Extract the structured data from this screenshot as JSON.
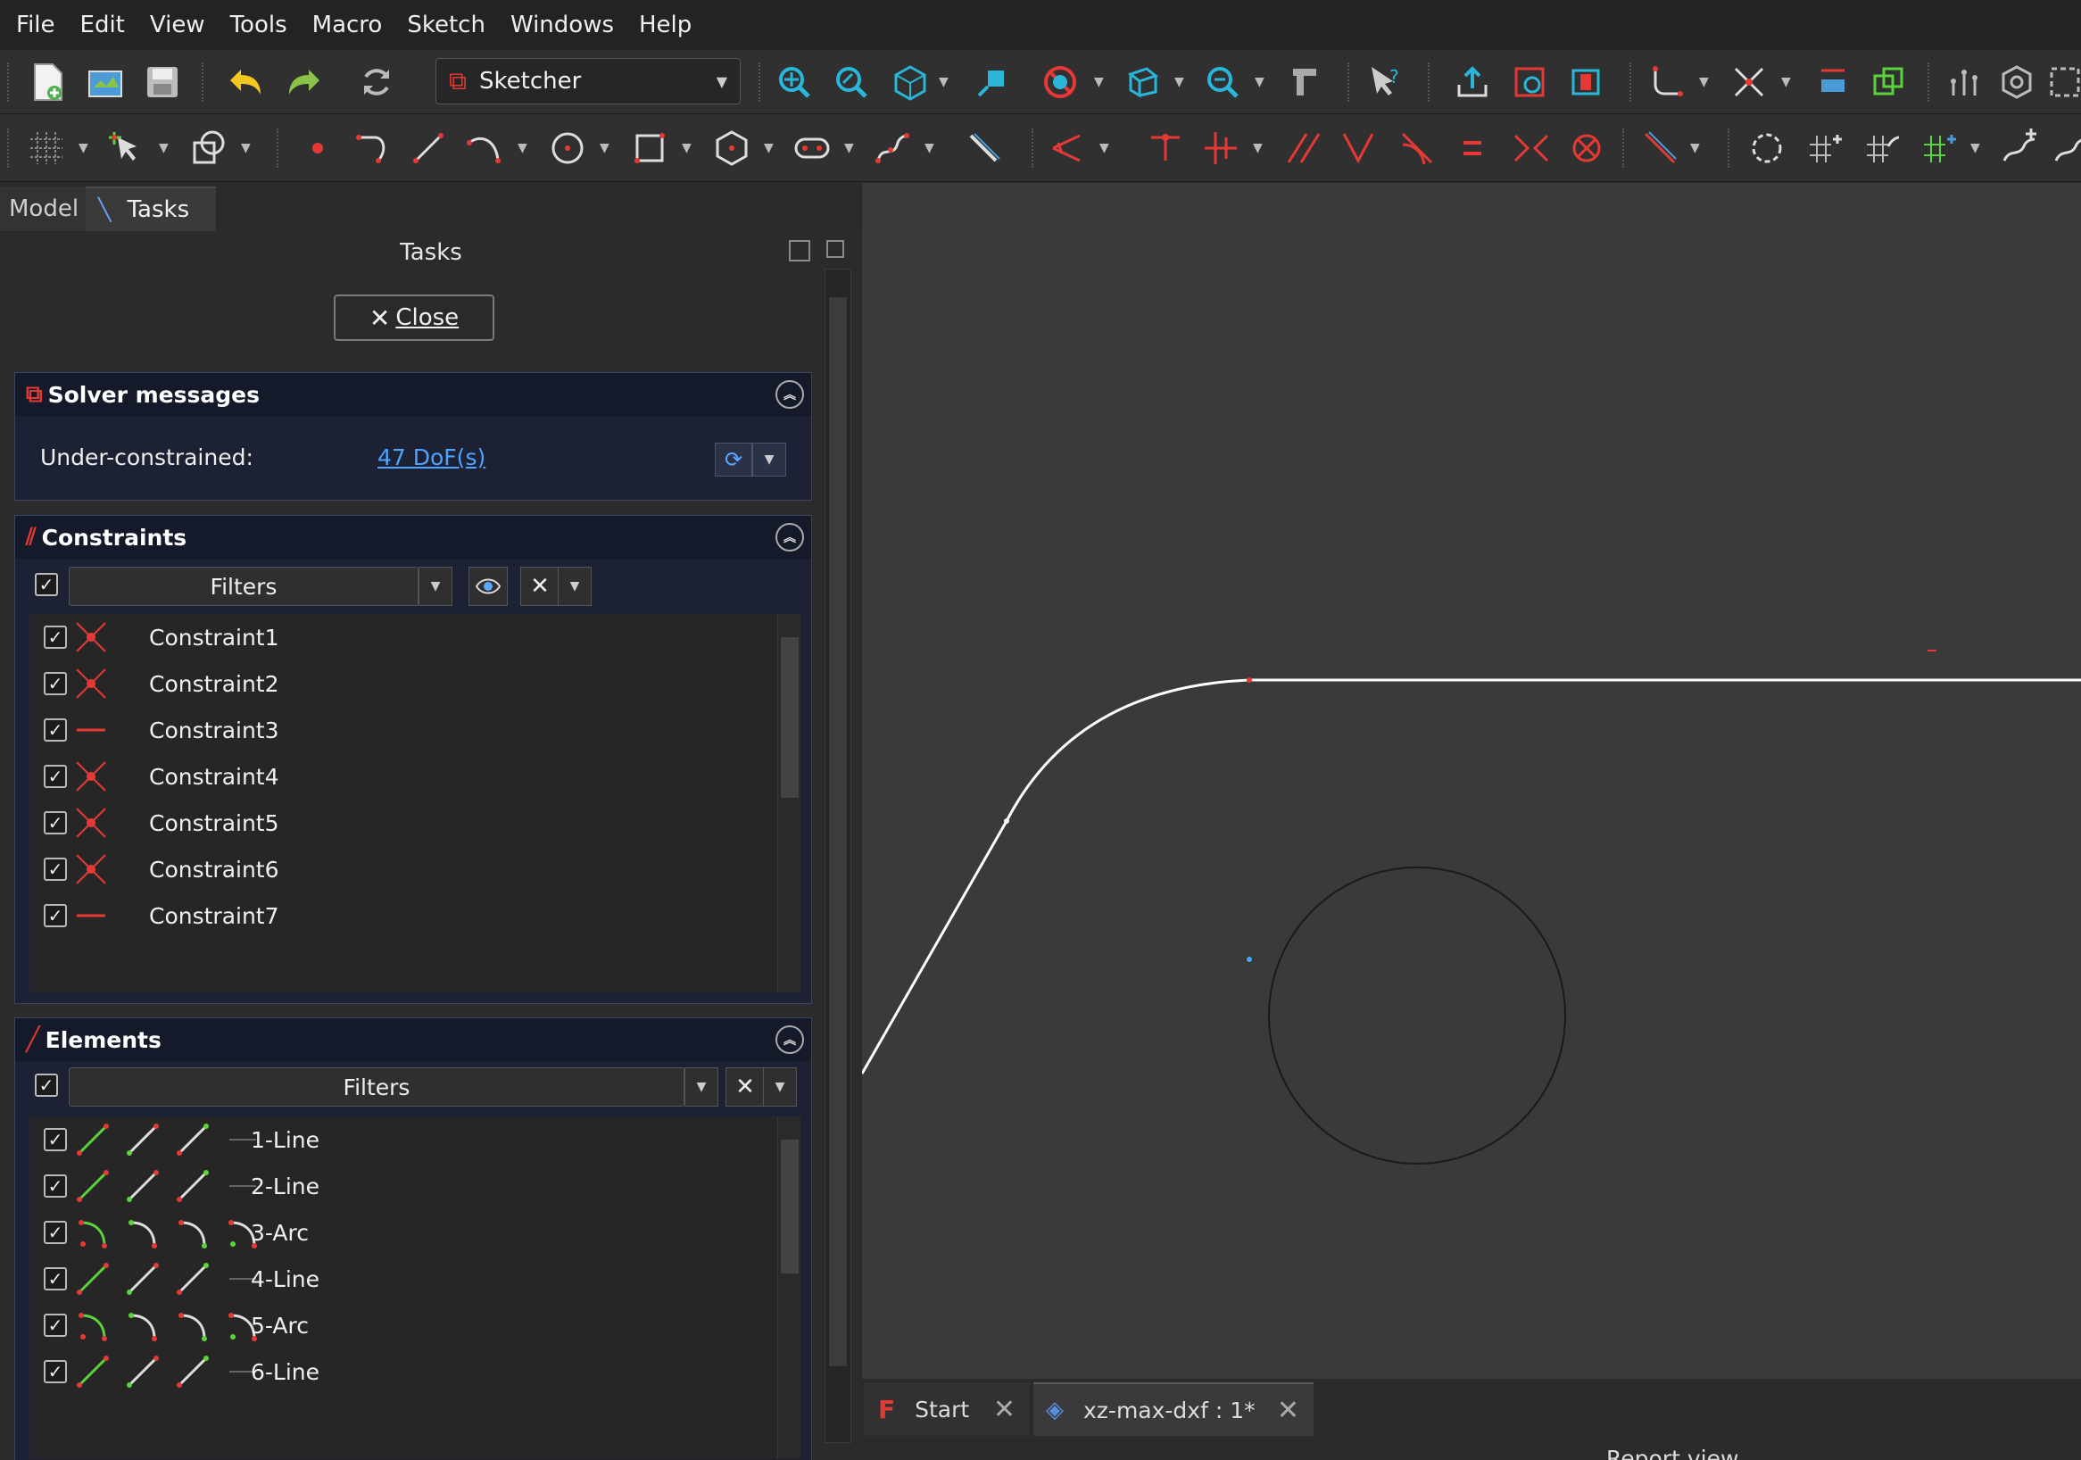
{
  "menubar": {
    "items": [
      "File",
      "Edit",
      "View",
      "Tools",
      "Macro",
      "Sketch",
      "Windows",
      "Help"
    ]
  },
  "toolbar": {
    "workbench": "Sketcher"
  },
  "panel_tabs": {
    "model": "Model",
    "tasks": "Tasks"
  },
  "tasks": {
    "title": "Tasks",
    "close_label": "Close"
  },
  "solver": {
    "title": "Solver messages",
    "status_label": "Under-constrained:",
    "dof_link": "47 DoF(s)"
  },
  "constraints": {
    "title": "Constraints",
    "filter_label": "Filters",
    "items": [
      {
        "label": "Constraint1",
        "icon": "coincident-icon"
      },
      {
        "label": "Constraint2",
        "icon": "coincident-icon"
      },
      {
        "label": "Constraint3",
        "icon": "horizontal-icon"
      },
      {
        "label": "Constraint4",
        "icon": "coincident-icon"
      },
      {
        "label": "Constraint5",
        "icon": "coincident-icon"
      },
      {
        "label": "Constraint6",
        "icon": "coincident-icon"
      },
      {
        "label": "Constraint7",
        "icon": "horizontal-icon"
      }
    ]
  },
  "elements": {
    "title": "Elements",
    "filter_label": "Filters",
    "items": [
      {
        "label": "1-Line",
        "type": "line"
      },
      {
        "label": "2-Line",
        "type": "line"
      },
      {
        "label": "3-Arc",
        "type": "arc"
      },
      {
        "label": "4-Line",
        "type": "line"
      },
      {
        "label": "5-Arc",
        "type": "arc"
      },
      {
        "label": "6-Line",
        "type": "line"
      }
    ]
  },
  "doc_tabs": {
    "start": "Start",
    "document": "xz-max-dxf : 1*"
  },
  "report_view": "Report view",
  "colors": {
    "accent_red": "#e53935",
    "link_blue": "#4ea3ff",
    "green": "#5bd33a",
    "section_bg": "#1c2233"
  }
}
